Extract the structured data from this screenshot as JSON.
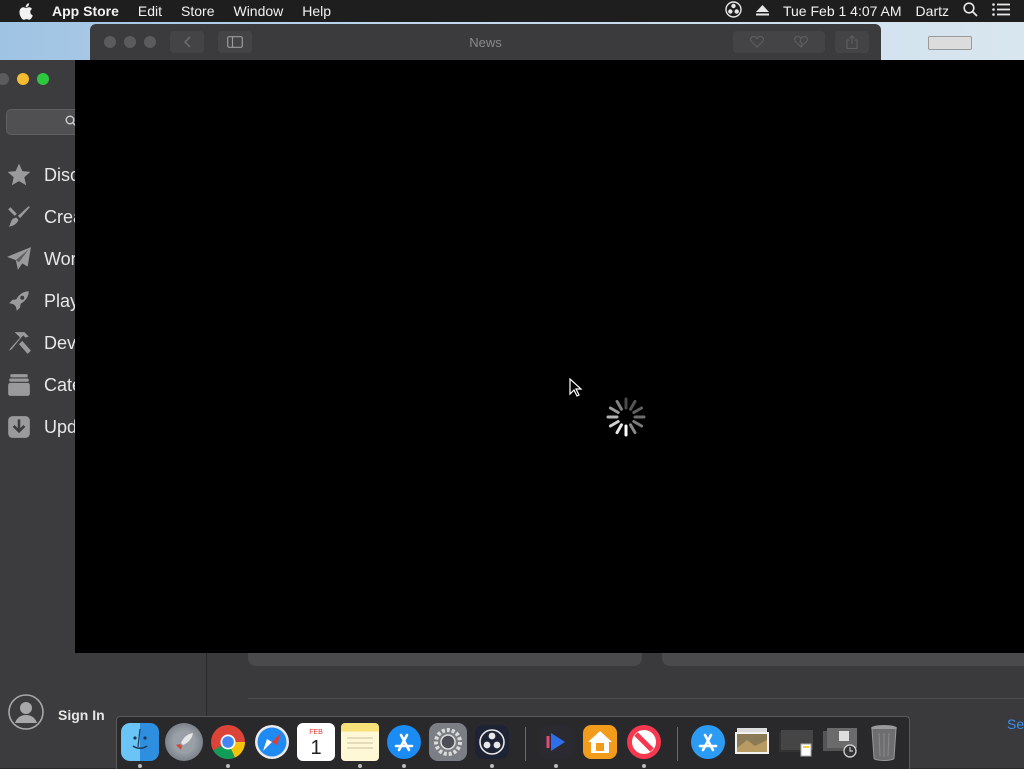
{
  "menubar": {
    "app_name": "App Store",
    "menus": [
      "Edit",
      "Store",
      "Window",
      "Help"
    ],
    "clock": "Tue Feb 1  4:07 AM",
    "user": "Dartz"
  },
  "appstore": {
    "sidebar": {
      "items": [
        {
          "label": "Disc",
          "icon": "star-icon"
        },
        {
          "label": "Crea",
          "icon": "paintbrush-icon"
        },
        {
          "label": "Wor",
          "icon": "paper-plane-icon"
        },
        {
          "label": "Play",
          "icon": "rocket-icon"
        },
        {
          "label": "Dev",
          "icon": "hammer-icon"
        },
        {
          "label": "Cate",
          "icon": "stack-icon"
        },
        {
          "label": "Upd",
          "icon": "download-icon"
        }
      ],
      "sign_in": "Sign In"
    },
    "see_link": "Se"
  },
  "news_window": {
    "title": "News",
    "state": "loading"
  },
  "dock": {
    "apps": [
      "Finder",
      "Launchpad",
      "Google Chrome",
      "Safari",
      "Calendar",
      "Notes",
      "App Store",
      "System Preferences",
      "OBS",
      "Infuse",
      "Home",
      "News",
      "App Store Downloads",
      "Photos Stack",
      "Documents Stack",
      "Screenshots Stack",
      "Trash"
    ],
    "calendar_month": "FEB",
    "calendar_day": "1"
  },
  "colors": {
    "accent_link": "#3b8ef0",
    "traffic_yellow": "#f3bd2f",
    "traffic_green": "#2ec840"
  }
}
